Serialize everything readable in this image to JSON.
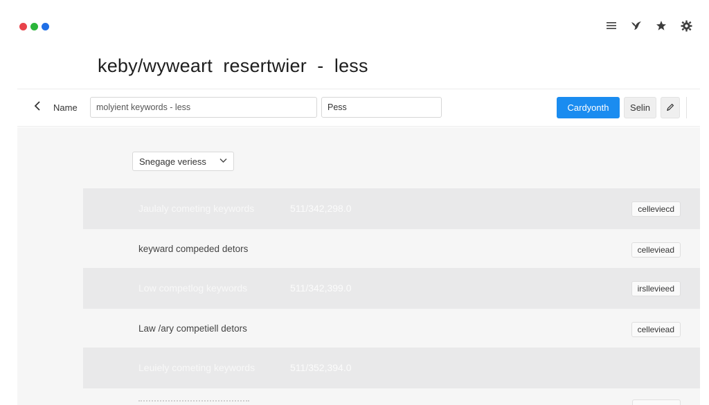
{
  "window": {
    "dot_colors": [
      "#e8424a",
      "#2bb53a",
      "#1f6fe6"
    ],
    "icons": [
      "list-icon",
      "bird-icon",
      "star-icon",
      "gear-icon"
    ]
  },
  "page": {
    "title": "keby/wyweart  resertwier  -  less"
  },
  "toolbar": {
    "name_label": "Name",
    "keyword_value": "molyient keywords - less",
    "second_value": "Pess",
    "primary_button": "Cardyonth",
    "secondary_button": "Selin",
    "edit_icon": "pencil-icon"
  },
  "filter": {
    "selected": "Snegage veriess"
  },
  "rows": [
    {
      "style": "dark",
      "label": "Jaulaly cometing keywords",
      "number": "511/342,298.0",
      "badge": "celleviecd"
    },
    {
      "style": "light",
      "label": "keyward compeded detors",
      "number": "",
      "badge": "celleviead"
    },
    {
      "style": "dark",
      "label": "Low competlog keywords",
      "number": "511/342,399.0",
      "badge": "irsllevieed"
    },
    {
      "style": "light",
      "label": "Law /ary competiell detors",
      "number": "",
      "badge": "celleviead"
    },
    {
      "style": "dark",
      "label": "Leuiely cometing keywords",
      "number": "511/352,394.0",
      "badge": ""
    }
  ]
}
